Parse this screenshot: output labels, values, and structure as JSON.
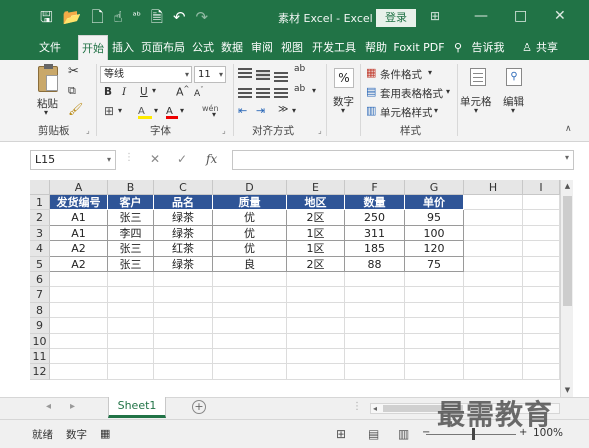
{
  "window": {
    "title": "素材 Excel - Excel",
    "login_label": "登录",
    "qat_icons": [
      "save-icon",
      "open-icon",
      "new-icon",
      "touch-mode-icon",
      "spelling-icon",
      "print-preview-icon",
      "undo-icon",
      "redo-icon"
    ],
    "qat_glyphs": [
      "🖫",
      "📂",
      "🗋",
      "☝",
      "ᵃᵇ",
      "🗎",
      "↶",
      "↷"
    ],
    "min_glyph": "—",
    "max_glyph": "□",
    "close_glyph": "✕",
    "ribbon_opt_glyph": "⊞"
  },
  "tabs": [
    "文件",
    "开始",
    "插入",
    "页面布局",
    "公式",
    "数据",
    "审阅",
    "视图",
    "开发工具",
    "帮助",
    "Foxit PDF"
  ],
  "tell_me": "告诉我",
  "share": "共享",
  "ribbon": {
    "clipboard": {
      "paste": "粘贴",
      "group": "剪贴板"
    },
    "font": {
      "name": "等线",
      "size": "11",
      "bold": "B",
      "italic": "I",
      "underline": "U",
      "grow": "A",
      "shrink": "A",
      "font_color": "A",
      "fill_glyph": "A",
      "phonetic": "wén",
      "group": "字体"
    },
    "alignment": {
      "wrap_glyph": "ab",
      "orient_glyph": "ab",
      "group": "对齐方式"
    },
    "number": {
      "percent": "%",
      "label": "数字"
    },
    "styles": {
      "conditional": "条件格式",
      "table": "套用表格格式",
      "cell": "单元格样式",
      "group": "样式"
    },
    "cells": {
      "label": "单元格"
    },
    "editing": {
      "label": "编辑"
    }
  },
  "formula_bar": {
    "name_box": "L15",
    "fx": "fx",
    "cancel": "✕",
    "enter": "✓",
    "value": ""
  },
  "columns": [
    "A",
    "B",
    "C",
    "D",
    "E",
    "F",
    "G",
    "H",
    "I"
  ],
  "rows": [
    "1",
    "2",
    "3",
    "4",
    "5",
    "6",
    "7",
    "8",
    "9",
    "10",
    "11",
    "12"
  ],
  "table": {
    "headers": [
      "发货编号",
      "客户",
      "品名",
      "质量",
      "地区",
      "数量",
      "单价"
    ],
    "rows": [
      [
        "A1",
        "张三",
        "绿茶",
        "优",
        "2区",
        "250",
        "95"
      ],
      [
        "A1",
        "李四",
        "绿茶",
        "优",
        "1区",
        "311",
        "100"
      ],
      [
        "A2",
        "张三",
        "红茶",
        "优",
        "1区",
        "185",
        "120"
      ],
      [
        "A2",
        "张三",
        "绿茶",
        "良",
        "2区",
        "88",
        "75"
      ]
    ]
  },
  "sheet_tab": "Sheet1",
  "status": {
    "ready": "就绪",
    "mode": "数字",
    "zoom": "100%"
  },
  "watermark": "最需教育",
  "colors": {
    "excel_green": "#217346",
    "header_fill": "#2f5597"
  }
}
